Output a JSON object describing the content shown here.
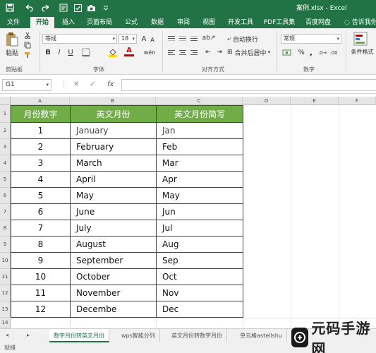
{
  "window": {
    "title": "案例.xlsx - Excel"
  },
  "quick_access": {
    "save_icon": "save-icon",
    "undo_icon": "undo-icon",
    "redo_icon": "redo-icon",
    "form_icon": "form-icon",
    "camera_icon": "camera-icon"
  },
  "tabs": [
    {
      "label": "文件"
    },
    {
      "label": "开始"
    },
    {
      "label": "插入"
    },
    {
      "label": "页面布局"
    },
    {
      "label": "公式"
    },
    {
      "label": "数据"
    },
    {
      "label": "审阅"
    },
    {
      "label": "视图"
    },
    {
      "label": "开发工具"
    },
    {
      "label": "PDF工具集"
    },
    {
      "label": "百度网盘"
    }
  ],
  "tell_me": "告诉我你",
  "ribbon": {
    "paste_label": "粘贴",
    "clipboard_label": "剪贴板",
    "font_name": "等线",
    "font_size": "18",
    "font_label": "字体",
    "bold": "B",
    "italic": "I",
    "underline": "U",
    "font_color_glyph": "A",
    "wrap_text": "自动换行",
    "merge_center": "合并后居中",
    "alignment_label": "对齐方式",
    "number_format": "常规",
    "number_label": "数字",
    "percent": "%",
    "comma": ",",
    "conditional_format": "条件格式"
  },
  "formula_bar": {
    "name_box": "G1",
    "cancel": "✕",
    "enter": "✓",
    "fx": "fx",
    "formula": ""
  },
  "grid": {
    "columns": [
      "A",
      "B",
      "C",
      "D",
      "E",
      "F"
    ],
    "rows": [
      "1",
      "2",
      "3",
      "4",
      "5",
      "6",
      "7",
      "8",
      "9",
      "10",
      "11",
      "12",
      "13",
      "14"
    ]
  },
  "table": {
    "headers": [
      "月份数字",
      "英文月份",
      "英文月份简写"
    ],
    "rows": [
      {
        "num": "1",
        "en": "January",
        "ab": "Jan"
      },
      {
        "num": "2",
        "en": "February",
        "ab": "Feb"
      },
      {
        "num": "3",
        "en": "March",
        "ab": "Mar"
      },
      {
        "num": "4",
        "en": "April",
        "ab": "Apr"
      },
      {
        "num": "5",
        "en": "May",
        "ab": "May"
      },
      {
        "num": "6",
        "en": "June",
        "ab": "Jun"
      },
      {
        "num": "7",
        "en": "July",
        "ab": "Jul"
      },
      {
        "num": "8",
        "en": "August",
        "ab": "Aug"
      },
      {
        "num": "9",
        "en": "September",
        "ab": "Sep"
      },
      {
        "num": "10",
        "en": "October",
        "ab": "Oct"
      },
      {
        "num": "11",
        "en": "November",
        "ab": "Nov"
      },
      {
        "num": "12",
        "en": "Decembe",
        "ab": "Dec"
      }
    ],
    "header_color": "#70ad47"
  },
  "sheets": [
    {
      "label": "数字月份转英文月份",
      "active": true
    },
    {
      "label": "wps智能分列",
      "active": false
    },
    {
      "label": "英文月份转数字月份",
      "active": false
    },
    {
      "label": "单元格astellshu",
      "active": false
    }
  ],
  "status": {
    "text": "就绪"
  },
  "watermark": {
    "text": "元码手游网"
  },
  "colors": {
    "accent": "#217346",
    "header_green": "#70ad47"
  }
}
